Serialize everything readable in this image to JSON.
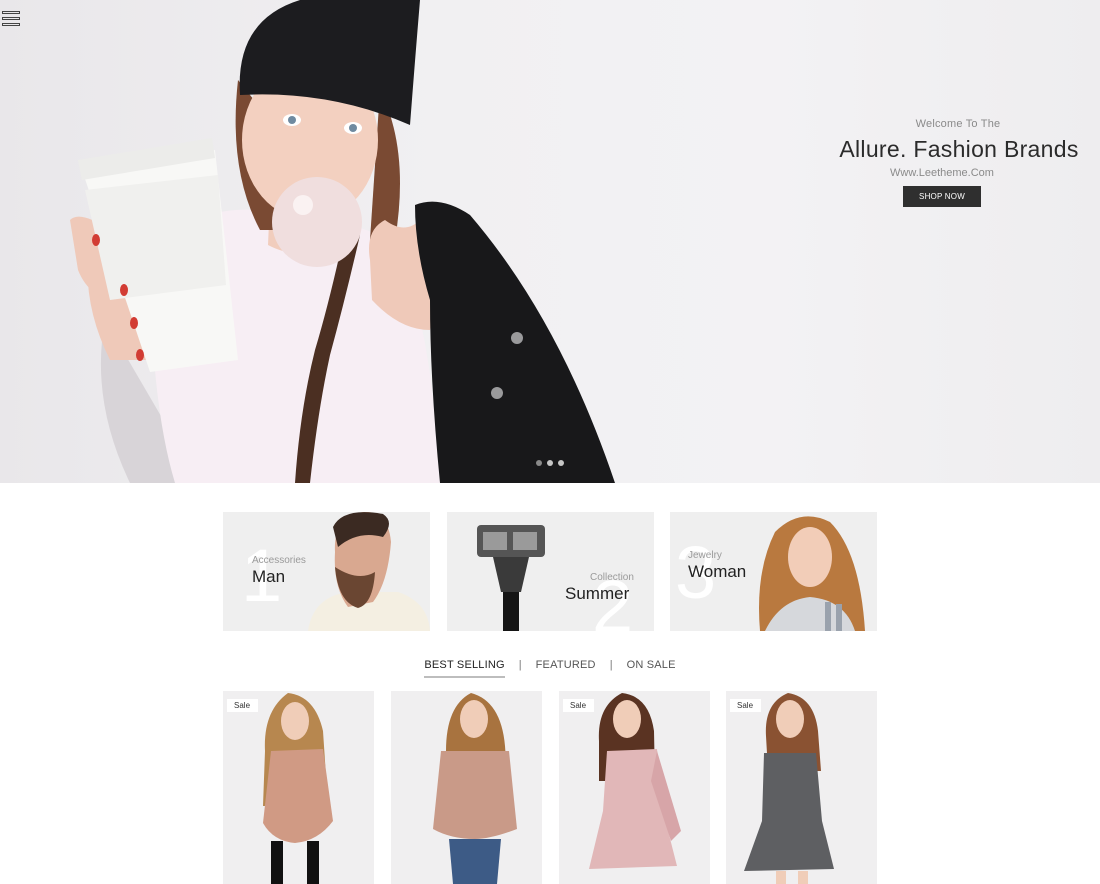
{
  "hero": {
    "welcome": "Welcome To The",
    "title": "Allure. Fashion Brands",
    "url": "Www.Leetheme.Com",
    "button": "SHOP NOW"
  },
  "banners": [
    {
      "number": "1",
      "category": "Accessories",
      "name": "Man"
    },
    {
      "number": "2",
      "category": "Collection",
      "name": "Summer"
    },
    {
      "number": "3",
      "category": "Jewelry",
      "name": "Woman"
    }
  ],
  "tabs": [
    {
      "label": "BEST SELLING",
      "active": true
    },
    {
      "label": "FEATURED",
      "active": false
    },
    {
      "label": "ON SALE",
      "active": false
    }
  ],
  "tab_separator": "|",
  "products": [
    {
      "badge": "Sale"
    },
    {
      "badge": ""
    },
    {
      "badge": "Sale"
    },
    {
      "badge": "Sale"
    }
  ],
  "colors": {
    "accent_button": "#2f2f2f",
    "background": "#ffffff"
  }
}
